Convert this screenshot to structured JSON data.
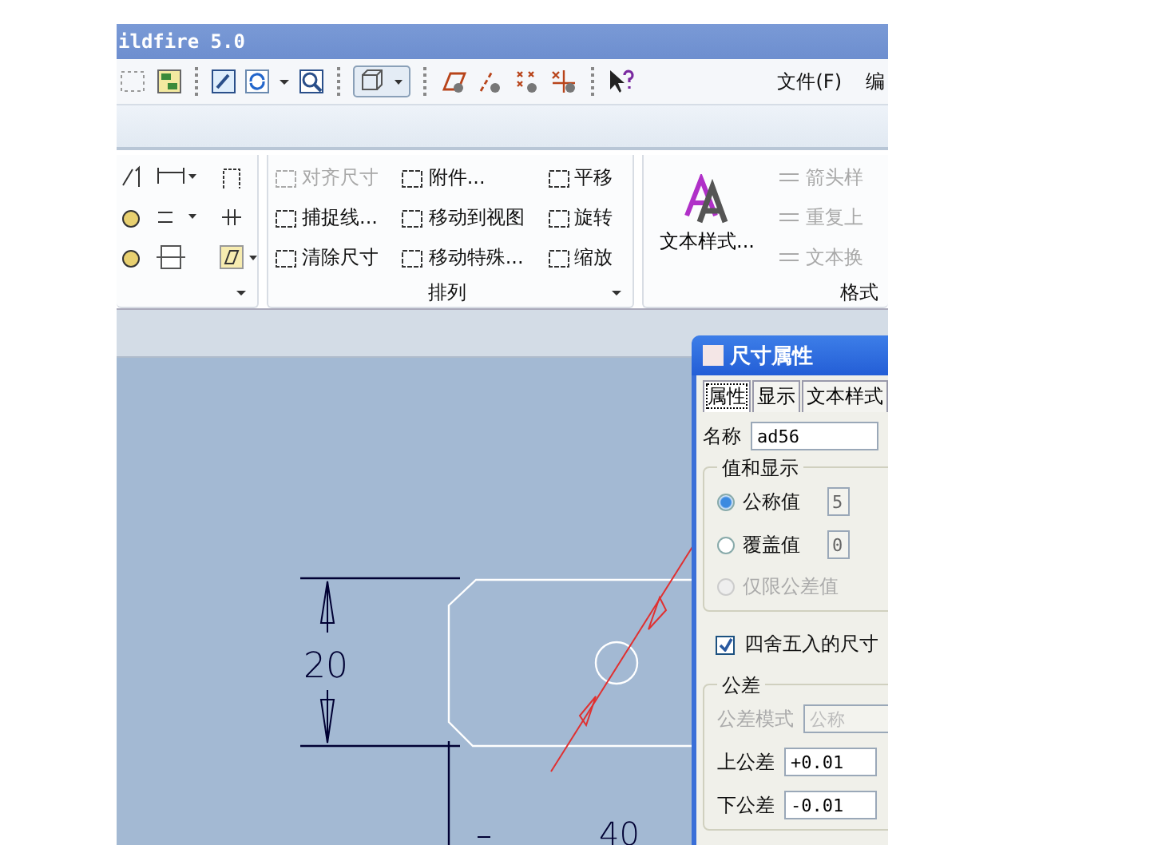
{
  "window": {
    "title": "ildfire 5.0"
  },
  "menu": [
    "文件(F)",
    "编"
  ],
  "ribbon": {
    "groups": [
      {
        "label": "排列",
        "items": [
          {
            "label": "对齐尺寸",
            "disabled": true
          },
          {
            "label": "捕捉线...",
            "disabled": false
          },
          {
            "label": "清除尺寸",
            "disabled": false
          },
          {
            "label": "附件...",
            "disabled": false
          },
          {
            "label": "移动到视图",
            "disabled": false
          },
          {
            "label": "移动特殊...",
            "disabled": false
          },
          {
            "label": "平移",
            "disabled": false
          },
          {
            "label": "旋转",
            "disabled": false
          },
          {
            "label": "缩放",
            "disabled": false
          }
        ]
      },
      {
        "label": "格式",
        "large_button": "文本样式...",
        "items": [
          {
            "label": "箭头样",
            "disabled": true
          },
          {
            "label": "重复上",
            "disabled": true
          },
          {
            "label": "文本换",
            "disabled": true
          }
        ]
      }
    ]
  },
  "drawing": {
    "dimension_labels": [
      "20",
      "40"
    ]
  },
  "dialog": {
    "title": "尺寸属性",
    "tabs": [
      {
        "label": "属性",
        "selected": true
      },
      {
        "label": "显示",
        "selected": false
      },
      {
        "label": "文本样式",
        "selected": false
      }
    ],
    "name": {
      "label": "名称",
      "value": "ad56"
    },
    "value_group": {
      "label": "值和显示",
      "options": [
        {
          "label": "公称值",
          "selected": true,
          "disabled": false,
          "value": "5"
        },
        {
          "label": "覆盖值",
          "selected": false,
          "disabled": false,
          "value": "0"
        },
        {
          "label": "仅限公差值",
          "disabled": true
        }
      ]
    },
    "round": {
      "label": "四舍五入的尺寸",
      "checked": true
    },
    "tolerance_group": {
      "label": "公差",
      "mode": {
        "label": "公差模式",
        "value": "公称",
        "disabled": true
      },
      "upper": {
        "label": "上公差",
        "value": "+0.01"
      },
      "lower": {
        "label": "下公差",
        "value": "-0.01"
      }
    }
  }
}
